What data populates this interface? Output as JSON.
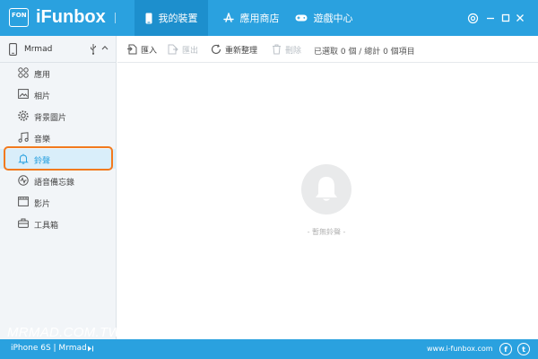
{
  "app": {
    "logo_text": "FON",
    "title": "iFunbox"
  },
  "tabs": [
    {
      "label": "我的裝置",
      "icon": "phone-icon",
      "active": true
    },
    {
      "label": "應用商店",
      "icon": "app-store-icon",
      "active": false
    },
    {
      "label": "遊戲中心",
      "icon": "gamepad-icon",
      "active": false
    }
  ],
  "window_controls": [
    "settings-icon",
    "minimize-icon",
    "maximize-icon",
    "close-icon"
  ],
  "sidebar": {
    "device_name": "Mrmad",
    "items": [
      {
        "label": "應用",
        "icon": "apps-grid-icon"
      },
      {
        "label": "相片",
        "icon": "photo-icon"
      },
      {
        "label": "背景圖片",
        "icon": "wallpaper-icon"
      },
      {
        "label": "音樂",
        "icon": "music-icon"
      },
      {
        "label": "鈴聲",
        "icon": "bell-icon",
        "selected": true
      },
      {
        "label": "語音備忘錄",
        "icon": "voice-memo-icon"
      },
      {
        "label": "影片",
        "icon": "video-icon"
      },
      {
        "label": "工具箱",
        "icon": "toolbox-icon"
      }
    ],
    "watermark": "MRMAD.COM.TW"
  },
  "toolbar": {
    "import_label": "匯入",
    "export_label": "匯出",
    "refresh_label": "重新整理",
    "delete_label": "刪除",
    "status": "已選取 0 個 / 總計 0 個項目"
  },
  "content": {
    "empty_text": "- 暫無鈴聲 -"
  },
  "footer": {
    "device_info": "iPhone 6S | Mrmad",
    "url": "www.i-funbox.com",
    "facebook": "f",
    "twitter": "t"
  },
  "colors": {
    "primary": "#2aa1df",
    "active_tab": "#1d8fcd",
    "highlight": "#f27a1e",
    "sidebar_bg": "#f2f5f8"
  }
}
